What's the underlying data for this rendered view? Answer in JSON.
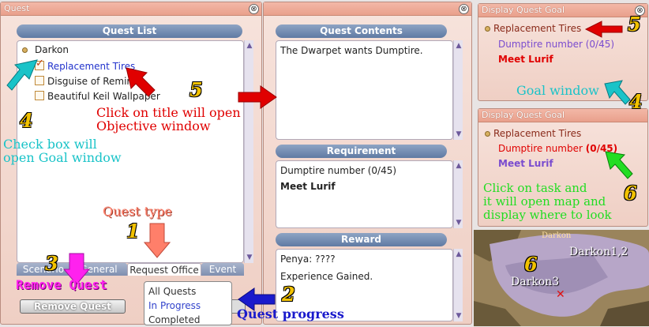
{
  "quest_window": {
    "title": "Quest",
    "close": "⊗",
    "list_header": "Quest List",
    "category": "Darkon",
    "quests": [
      "Replacement Tires",
      "Disguise of Remin",
      "Beautiful Keil Wallpaper"
    ],
    "tabs": [
      "Scenario",
      "General",
      "Request Office",
      "Event"
    ],
    "remove_button": "Remove Quest",
    "dropdown_options": [
      "All Quests",
      "In Progress",
      "Completed"
    ]
  },
  "contents_window": {
    "close": "⊗",
    "contents_header": "Quest Contents",
    "contents_text": "The Dwarpet wants Dumptire.",
    "requirement_header": "Requirement",
    "requirement_item": "Dumptire number (0/45)",
    "requirement_npc": "Meet Lurif",
    "reward_header": "Reward",
    "reward_penya": "Penya: ????",
    "reward_exp": "Experience Gained."
  },
  "goal_window_1": {
    "title": "Display Quest Goal",
    "close": "⊗",
    "quest": "Replacement Tires",
    "task": "Dumptire number (0/45)",
    "npc": "Meet Lurif"
  },
  "goal_window_2": {
    "title": "Display Quest Goal",
    "quest": "Replacement Tires",
    "task_label": "Dumptire number",
    "task_count": "(0/45)",
    "npc": "Meet Lurif"
  },
  "map": {
    "label_top": "Darkon",
    "label_right": "Darkon1,2",
    "label_bottom": "Darkon3",
    "marker": "✕"
  },
  "annotations": {
    "n1": "1",
    "n2": "2",
    "n3": "3",
    "n4": "4",
    "n5": "5",
    "n6": "6",
    "click_title_1": "Click on title will open",
    "click_title_2": "Objective window",
    "check_box_1": "Check box will",
    "check_box_2": "open Goal window",
    "quest_type": "Quest type",
    "remove_quest": "Remove Quest",
    "quest_progress": "Quest progress",
    "goal_window": "Goal window",
    "task_1": "Click on task and",
    "task_2": "it will open map and",
    "task_3": "display where to look"
  },
  "colors": {
    "red": "#e00000",
    "cyan": "#19c3c8",
    "green": "#22dd22",
    "magenta": "#ff22ee",
    "blue": "#1a1acc",
    "salmon": "#ff7f6a",
    "yellow": "#f2c200"
  }
}
